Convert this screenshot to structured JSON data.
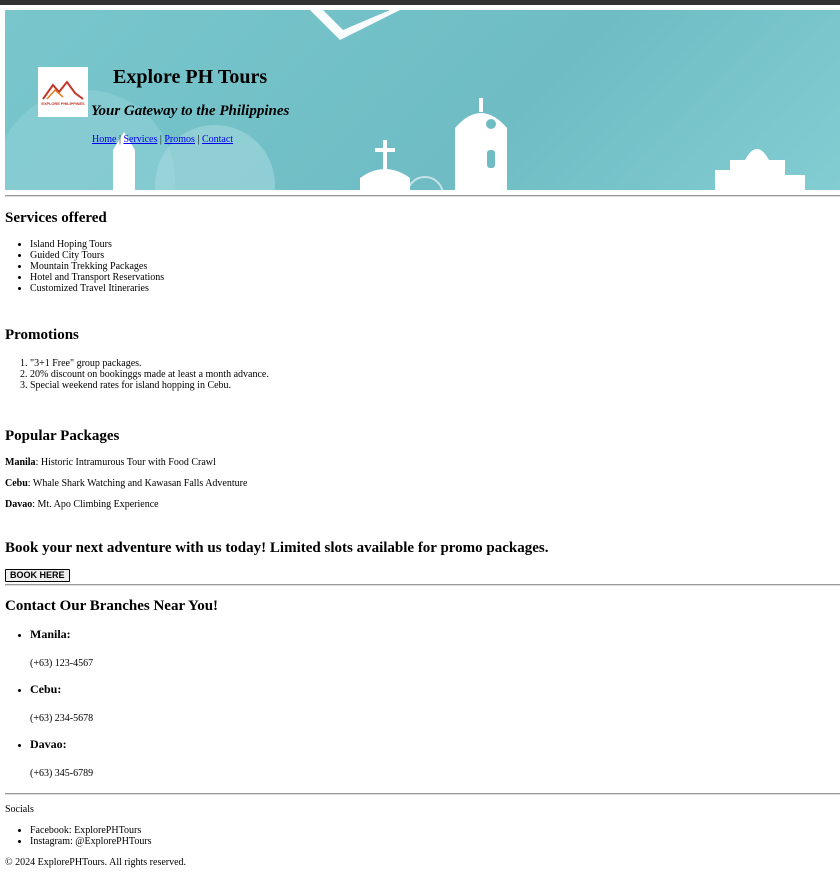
{
  "header": {
    "logo_text": "EXPLORE PHILIPPINES",
    "title": "Explore PH Tours",
    "tagline": "Your Gateway to the Philippines",
    "nav": [
      "Home",
      "Services",
      "Promos",
      "Contact"
    ],
    "nav_separator": "|"
  },
  "services": {
    "heading": "Services offered",
    "items": [
      "Island Hoping Tours",
      "Guided City Tours",
      "Mountain Trekking Packages",
      "Hotel and Transport Reservations",
      "Customized Travel Itineraries"
    ]
  },
  "promotions": {
    "heading": "Promotions",
    "items": [
      "\"3+1 Free\" group packages.",
      "20% discount on bookinggs made at least a month advance.",
      "Special weekend rates for island hopping in Cebu."
    ]
  },
  "packages": {
    "heading": "Popular Packages",
    "items": [
      {
        "city": "Manila",
        "desc": ": Historic Intramurous Tour with Food Crawl"
      },
      {
        "city": "Cebu",
        "desc": ": Whale Shark Watching and Kawasan Falls Adventure"
      },
      {
        "city": "Davao",
        "desc": ": Mt. Apo Climbing Experience"
      }
    ]
  },
  "booking": {
    "heading": "Book your next adventure with us today! Limited slots available for promo packages.",
    "button": "BOOK HERE"
  },
  "contact": {
    "heading": "Contact Our Branches Near You!",
    "branches": [
      {
        "name": "Manila:",
        "phone": "(+63) 123-4567"
      },
      {
        "name": "Cebu:",
        "phone": "(+63) 234-5678"
      },
      {
        "name": "Davao:",
        "phone": "(+63) 345-6789"
      }
    ]
  },
  "footer": {
    "socials_title": "Socials",
    "socials": [
      "Facebook: ExplorePHTours",
      "Instagram: @ExplorePHTours"
    ],
    "copyright": "© 2024 ExplorePHTours. All rights reserved."
  },
  "colors": {
    "banner": "#79c7cd",
    "link": "#0000ee"
  }
}
